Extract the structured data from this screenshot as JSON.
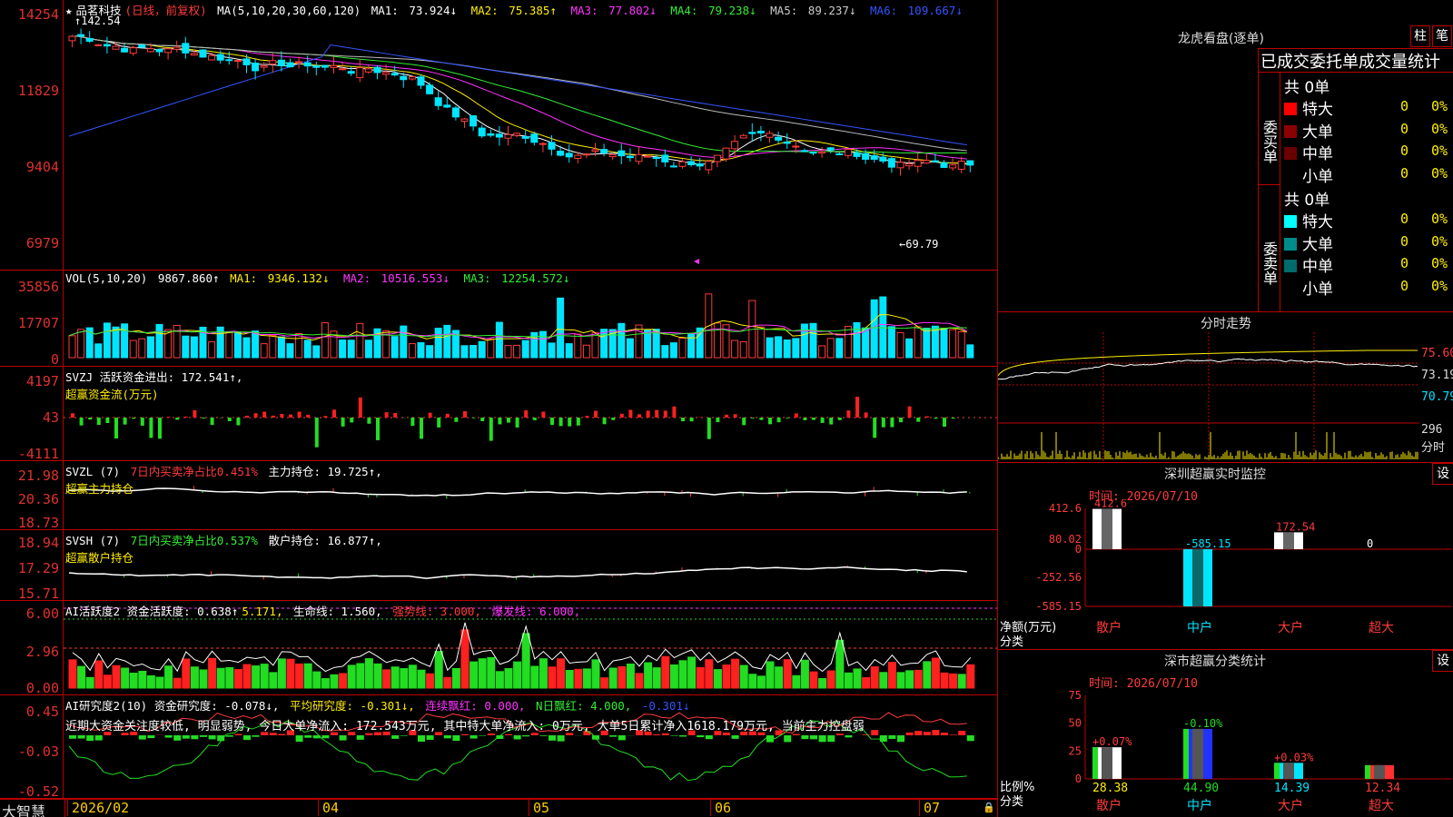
{
  "main": {
    "stock": "品茗科技",
    "mode": "(日线，前复权)",
    "ma_label": "MA(5,10,20,30,60,120)",
    "ma": [
      {
        "label": "MA1:",
        "value": "73.924↓",
        "color": "#ffffff"
      },
      {
        "label": "MA2:",
        "value": "75.385↑",
        "color": "#ffee00"
      },
      {
        "label": "MA3:",
        "value": "77.802↓",
        "color": "#ff33ff"
      },
      {
        "label": "MA4:",
        "value": "79.238↓",
        "color": "#33ee33"
      },
      {
        "label": "MA5:",
        "value": "89.237↓",
        "color": "#cccccc"
      },
      {
        "label": "MA6:",
        "value": "109.667↓",
        "color": "#3355ff"
      }
    ],
    "yticks": [
      "14254",
      "11829",
      "9404",
      "6979"
    ],
    "high_label": "142.54",
    "low_label": "←69.79"
  },
  "vol": {
    "label": "VOL(5,10,20)",
    "value": "9867.860↑",
    "ma": [
      {
        "label": "MA1:",
        "value": "9346.132↓"
      },
      {
        "label": "MA2:",
        "value": "10516.553↓"
      },
      {
        "label": "MA3:",
        "value": "12254.572↓"
      }
    ],
    "yticks": [
      "35856",
      "17707",
      "0"
    ]
  },
  "svzj": {
    "line1": "SVZJ  活跃资金进出: 172.541↑,",
    "line2": "超赢资金流(万元)",
    "yticks": [
      "4197",
      "43",
      "-4111"
    ]
  },
  "svzl": {
    "prefix": "SVZL (7)",
    "ratio": "7日内买卖净占比0.451%",
    "hold": "主力持仓: 19.725↑,",
    "line2": "超赢主力持仓",
    "yticks": [
      "21.98",
      "20.36",
      "18.73"
    ]
  },
  "svsh": {
    "prefix": "SVSH (7)",
    "ratio": "7日内买卖净占比0.537%",
    "hold": "散户持仓: 16.877↑,",
    "line2": "超赢散户持仓",
    "yticks": [
      "18.94",
      "17.29",
      "15.71"
    ]
  },
  "ai1": {
    "label": "AI活跃度2 资金活跃度: 0.638↑",
    "v2": "5.171,",
    "life": "生命线: 1.560,",
    "strong": "强势线: 3.000,",
    "burst": "爆发线: 6.000,",
    "yticks": [
      "6.00",
      "2.96",
      "0.00"
    ]
  },
  "ai2": {
    "label": "AI研究度2(10) 资金研究度: -0.078↓,",
    "avg": "平均研究度: -0.301↓,",
    "red": "连续飘红: 0.000,",
    "nred": "N日飘红: 4.000,",
    "last": "-0.301↓",
    "comment": "近期大资金关注度较低, 明显弱势, 今日大单净流入: 172.543万元, 其中特大单净流入: 0万元, 大单5日累计净入1618.179万元, 当前主力控盘弱",
    "yticks": [
      "0.45",
      "-0.03",
      "-0.52"
    ]
  },
  "bottom": {
    "brand": "大智慧",
    "months": [
      "2026/02",
      "04",
      "05",
      "06",
      "07"
    ]
  },
  "lhb": {
    "title": "龙虎看盘(逐单)",
    "btn1": "柱",
    "btn2": "笔",
    "subtitle": "已成交委托单成交量统计",
    "buy_label": "委买单",
    "sell_label": "委卖单",
    "buy_total": "共 0单",
    "sell_total": "共 0单",
    "buy_rows": [
      {
        "name": "特大",
        "count": "0",
        "pct": "0%",
        "color": "#ff0000"
      },
      {
        "name": "大单",
        "count": "0",
        "pct": "0%",
        "color": "#8b0000"
      },
      {
        "name": "中单",
        "count": "0",
        "pct": "0%",
        "color": "#6b0000"
      },
      {
        "name": "小单",
        "count": "0",
        "pct": "0%",
        "color": "#000000"
      }
    ],
    "sell_rows": [
      {
        "name": "特大",
        "count": "0",
        "pct": "0%",
        "color": "#00ffff"
      },
      {
        "name": "大单",
        "count": "0",
        "pct": "0%",
        "color": "#008b8b"
      },
      {
        "name": "中单",
        "count": "0",
        "pct": "0%",
        "color": "#006b6b"
      },
      {
        "name": "小单",
        "count": "0",
        "pct": "0%",
        "color": "#000000"
      }
    ]
  },
  "minute": {
    "title": "分时走势",
    "yticks": [
      "75.60",
      "73.19",
      "70.79"
    ],
    "vol_label": "296",
    "vol_unit": "分时"
  },
  "sz_monitor": {
    "title": "深圳超赢实时监控",
    "settings": "设",
    "time": "时间: 2026/07/10",
    "yticks": [
      "412.6",
      "80.02",
      "0",
      "-252.56",
      "-585.15"
    ],
    "bars": [
      {
        "cat": "散户",
        "value": 412.6,
        "label": "412.6"
      },
      {
        "cat": "中户",
        "value": -585.15,
        "label": "-585.15"
      },
      {
        "cat": "大户",
        "value": 172.54,
        "label": "172.54"
      },
      {
        "cat": "超大",
        "value": 0,
        "label": "0"
      }
    ],
    "ylabel": "净额(万元)",
    "xlabel": "分类"
  },
  "sz_class": {
    "title": "深市超赢分类统计",
    "settings": "设",
    "time": "时间: 2026/07/10",
    "yticks": [
      "75",
      "50",
      "25",
      "0"
    ],
    "bars": [
      {
        "cat": "散户",
        "value": 28.38,
        "label": "28.38",
        "change": "+0.07%"
      },
      {
        "cat": "中户",
        "value": 44.9,
        "label": "44.90",
        "change": "-0.10%"
      },
      {
        "cat": "大户",
        "value": 14.39,
        "label": "14.39",
        "change": "+0.03%"
      },
      {
        "cat": "超大",
        "value": 12.34,
        "label": "12.34",
        "change": ""
      }
    ],
    "ylabel": "比例%",
    "xlabel": "分类"
  }
}
